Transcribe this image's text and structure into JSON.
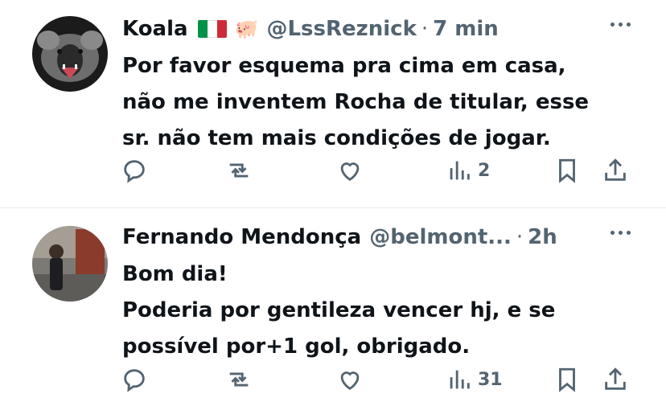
{
  "tweets": [
    {
      "name": "Koala",
      "handle": "@LssReznick",
      "time": "7 min",
      "lines": [
        "Por favor esquema pra cima em casa,",
        "não me inventem Rocha de titular, esse",
        "sr. não tem mais condições de jogar."
      ],
      "views": "2",
      "avatar_icon": "koala-roaring-avatar"
    },
    {
      "name": "Fernando Mendonça",
      "handle": "@belmont...",
      "time": "2h",
      "lines": [
        "Bom dia!",
        "Poderia por gentileza vencer hj, e se",
        "possível por+1 gol, obrigado."
      ],
      "views": "31",
      "avatar_icon": "person-street-avatar"
    }
  ],
  "colors": {
    "text": "#0f1419",
    "secondary": "#536471",
    "divider": "#e6ecf0"
  }
}
